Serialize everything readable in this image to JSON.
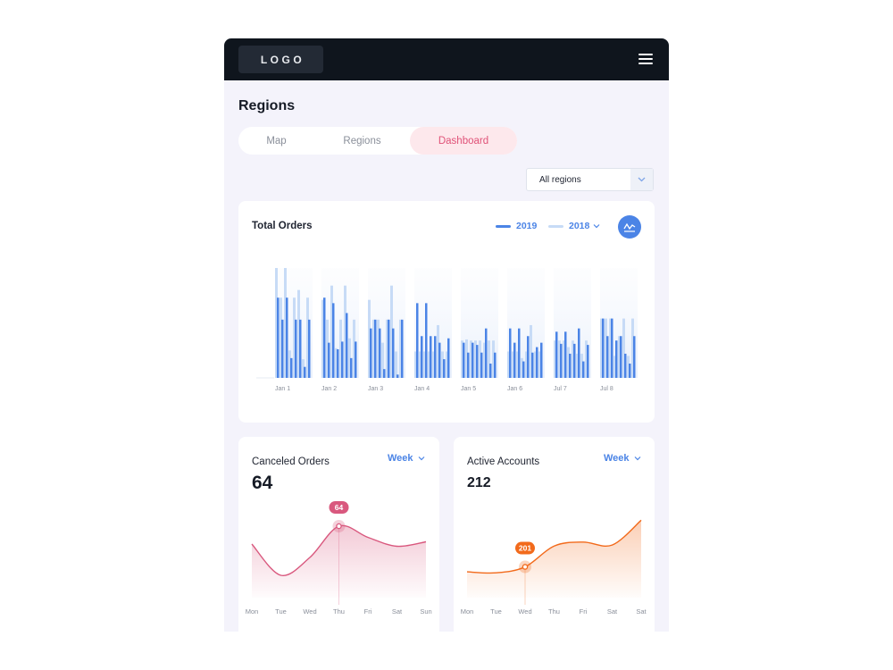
{
  "header": {
    "logo_text": "LOGO",
    "menu_icon": "hamburger-menu-icon"
  },
  "page": {
    "title": "Regions"
  },
  "tabs": [
    {
      "label": "Map",
      "active": false
    },
    {
      "label": "Regions",
      "active": false
    },
    {
      "label": "Dashboard",
      "active": true
    }
  ],
  "region_filter": {
    "selected": "All regions"
  },
  "colors": {
    "accent_blue": "#4b84e6",
    "blue_light": "#c7dbf6",
    "pink": "#d9587e",
    "orange": "#f26a1b",
    "dark": "#0f151d"
  },
  "total_orders": {
    "title": "Total Orders",
    "legend": [
      "2019",
      "2018"
    ],
    "chart_toggle_icon": "line-chart-icon",
    "chart_data": {
      "type": "bar",
      "categories": [
        "Jan 1",
        "Jan 2",
        "Jan 3",
        "Jan 4",
        "Jan 5",
        "Jan 6",
        "Jul 7",
        "Jul 8"
      ],
      "ylim": [
        0,
        100
      ],
      "series": [
        {
          "name": "2019",
          "values": [
            [
              73,
              73,
              45,
              68,
              32,
              45,
              42,
              54
            ],
            [
              53,
              32,
              53,
              38,
              23,
              32,
              31,
              38
            ],
            [
              73,
              68,
              45,
              68,
              32,
              45,
              42,
              54
            ],
            [
              18,
              26,
              8,
              38,
              30,
              15,
              22,
              34
            ],
            [
              53,
              33,
              53,
              38,
              23,
              38,
              31,
              38
            ],
            [
              53,
              59,
              45,
              32,
              45,
              23,
              45,
              22
            ],
            [
              10,
              18,
              3,
              17,
              13,
              28,
              15,
              13
            ],
            [
              53,
              33,
              53,
              36,
              23,
              32,
              30,
              38
            ]
          ]
        },
        {
          "name": "2018",
          "values": [
            [
              100,
              71,
              71,
              24,
              34,
              24,
              34,
              54
            ],
            [
              73,
              53,
              53,
              24,
              35,
              24,
              34,
              54
            ],
            [
              100,
              84,
              53,
              24,
              34,
              24,
              34,
              54
            ],
            [
              25,
              27,
              32,
              24,
              34,
              18,
              28,
              20
            ],
            [
              73,
              53,
              53,
              24,
              34,
              24,
              34,
              38
            ],
            [
              80,
              84,
              84,
              48,
              32,
              48,
              22,
              54
            ],
            [
              17,
              36,
              24,
              24,
              34,
              24,
              22,
              20
            ],
            [
              73,
              53,
              53,
              24,
              34,
              24,
              34,
              54
            ]
          ]
        }
      ]
    }
  },
  "canceled_orders": {
    "title": "Canceled Orders",
    "period": "Week",
    "value": "64",
    "tooltip": "64",
    "chart_data": {
      "type": "area",
      "x": [
        "Mon",
        "Tue",
        "Wed",
        "Thu",
        "Fri",
        "Sat",
        "Sun"
      ],
      "y": [
        48,
        20,
        36,
        64,
        54,
        46,
        50
      ],
      "ylim": [
        0,
        80
      ],
      "highlight_index": 3
    }
  },
  "active_accounts": {
    "title": "Active Accounts",
    "period": "Week",
    "value": "212",
    "tooltip": "201",
    "chart_data": {
      "type": "area",
      "x": [
        "Mon",
        "Tue",
        "Wed",
        "Thu",
        "Fri",
        "Sat",
        "Sat"
      ],
      "y": [
        196,
        195,
        201,
        222,
        226,
        223,
        248
      ],
      "ylim": [
        170,
        260
      ],
      "highlight_index": 2
    }
  }
}
